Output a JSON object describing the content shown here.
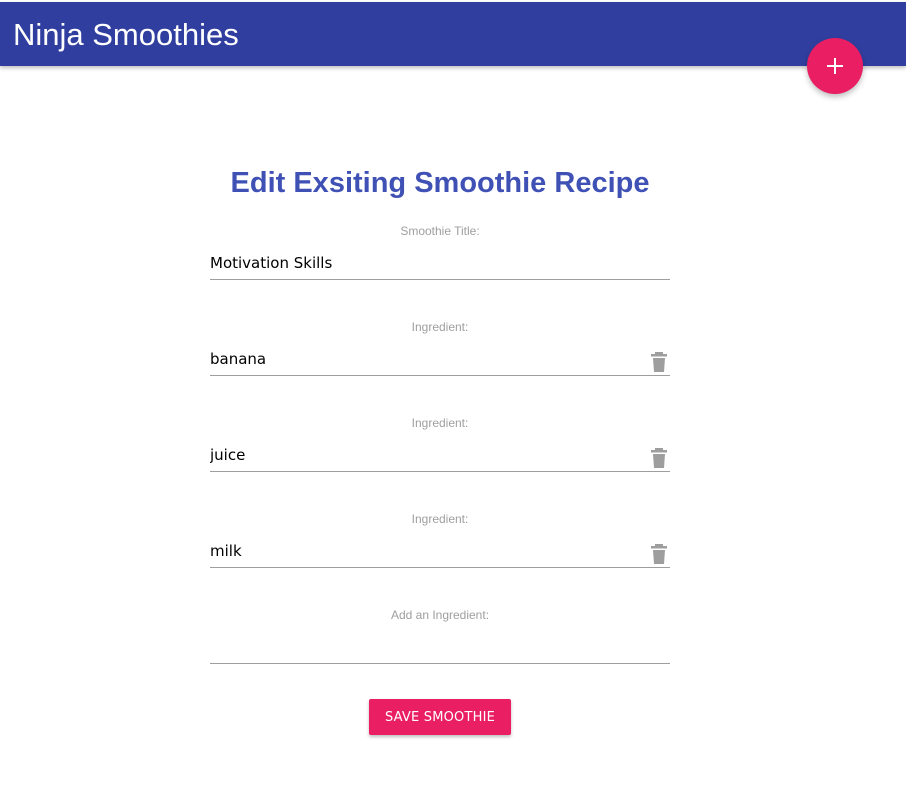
{
  "navbar": {
    "brand": "Ninja Smoothies",
    "color": "#303f9f"
  },
  "fab": {
    "icon": "plus-icon",
    "color": "#e91e63"
  },
  "page": {
    "title": "Edit Exsiting Smoothie Recipe"
  },
  "form": {
    "title_field": {
      "label": "Smoothie Title:",
      "value": "Motivation Skills"
    },
    "ingredients": [
      {
        "label": "Ingredient:",
        "value": "banana",
        "icon": "trash-icon"
      },
      {
        "label": "Ingredient:",
        "value": "juice",
        "icon": "trash-icon"
      },
      {
        "label": "Ingredient:",
        "value": "milk",
        "icon": "trash-icon"
      }
    ],
    "add_ingredient": {
      "label": "Add an Ingredient:",
      "value": ""
    },
    "save_label": "SAVE SMOOTHIE"
  }
}
